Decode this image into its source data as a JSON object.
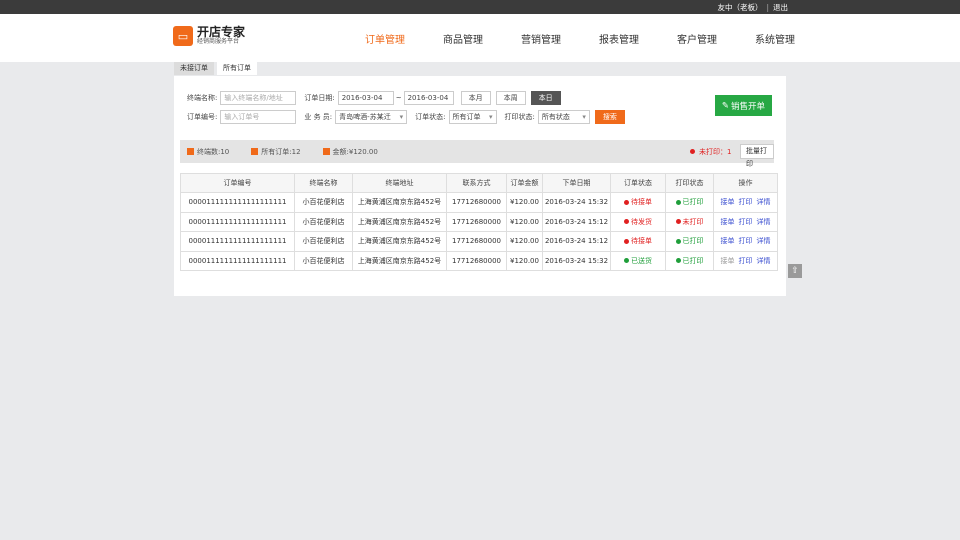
{
  "topbar": {
    "user": "友中（老板）",
    "logout": "退出"
  },
  "logo": {
    "title": "开店专家",
    "subtitle": "经销商服务平台"
  },
  "nav": [
    {
      "label": "订单管理",
      "active": true
    },
    {
      "label": "商品管理"
    },
    {
      "label": "营销管理"
    },
    {
      "label": "报表管理"
    },
    {
      "label": "客户管理"
    },
    {
      "label": "系统管理"
    }
  ],
  "tabs": [
    {
      "label": "未接订单"
    },
    {
      "label": "所有订单",
      "active": true
    }
  ],
  "filters": {
    "terminal_label": "终端名称:",
    "terminal_placeholder": "输入终端名称/地址",
    "date_label": "订单日期:",
    "date_from": "2016-03-04",
    "date_sep": "~",
    "date_to": "2016-03-04",
    "btn_month": "本月",
    "btn_week": "本周",
    "btn_today": "本日",
    "order_no_label": "订单编号:",
    "order_no_placeholder": "输入订单号",
    "salesman_label": "业 务 员:",
    "salesman_value": "青岛啤酒-苏某迁",
    "order_status_label": "订单状态:",
    "order_status_value": "所有订单",
    "print_status_label": "打印状态:",
    "print_status_value": "所有状态",
    "search_btn": "搜索"
  },
  "sale_button": "销售开单",
  "summary": {
    "terminals": "终端数:10",
    "orders": "所有订单:12",
    "amount": "金额:¥120.00",
    "unprinted": "未打印：1",
    "batch_print": "批量打印"
  },
  "table": {
    "headers": [
      "订单编号",
      "终端名称",
      "终端地址",
      "联系方式",
      "订单金额",
      "下单日期",
      "订单状态",
      "打印状态",
      "操作"
    ],
    "rows": [
      {
        "id": "0000111111111111111111",
        "name": "小百花便利店",
        "addr": "上海黄浦区南京东路452号",
        "phone": "17712680000",
        "amount": "¥120.00",
        "date": "2016-03-24  15:32",
        "status": "待接单",
        "print": "已打印"
      },
      {
        "id": "0000111111111111111111",
        "name": "小百花便利店",
        "addr": "上海黄浦区南京东路452号",
        "phone": "17712680000",
        "amount": "¥120.00",
        "date": "2016-03-24  15:12",
        "status": "待发货",
        "print": "未打印"
      },
      {
        "id": "0000111111111111111111",
        "name": "小百花便利店",
        "addr": "上海黄浦区南京东路452号",
        "phone": "17712680000",
        "amount": "¥120.00",
        "date": "2016-03-24  15:12",
        "status": "待接单",
        "print": "已打印"
      },
      {
        "id": "0000111111111111111111",
        "name": "小百花便利店",
        "addr": "上海黄浦区南京东路452号",
        "phone": "17712680000",
        "amount": "¥120.00",
        "date": "2016-03-24  15:32",
        "status": "已送货",
        "print": "已打印"
      }
    ],
    "actions": {
      "accept": "接单",
      "print": "打印",
      "detail": "详情"
    }
  },
  "colors": {
    "accent": "#f06a1a",
    "green": "#27a844",
    "red": "#e02020",
    "link": "#3a4ed0"
  }
}
